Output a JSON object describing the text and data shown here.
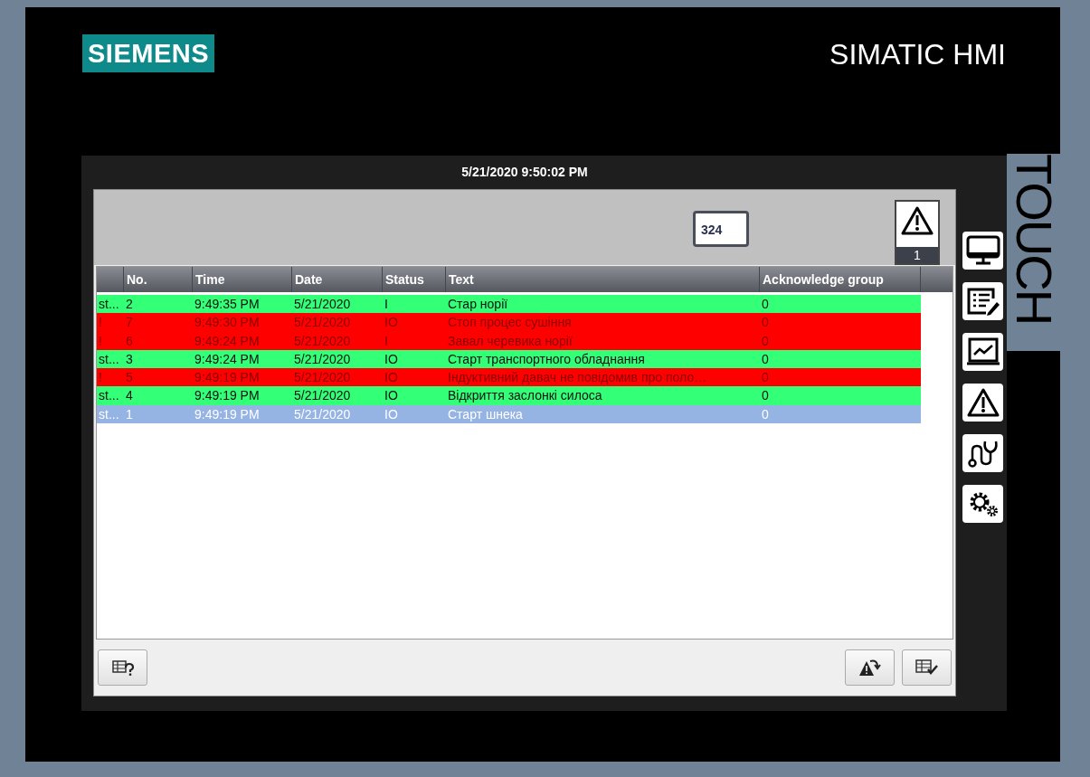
{
  "brand": {
    "logo": "SIEMENS",
    "product": "SIMATIC HMI",
    "edition": "TOUCH"
  },
  "screen": {
    "datetime": "5/21/2020 9:50:02 PM"
  },
  "alarm_view": {
    "counter": "324",
    "indicator_count": "1",
    "columns": [
      "",
      "No.",
      "Time",
      "Date",
      "Status",
      "Text",
      "Acknowledge group"
    ],
    "rows": [
      {
        "cells": [
          "st...",
          "2",
          "9:49:35 PM",
          "5/21/2020",
          "I",
          "Стар норії",
          "0"
        ],
        "kind": "status",
        "color": "#33ff77",
        "selected": false
      },
      {
        "cells": [
          "!",
          "7",
          "9:49:30 PM",
          "5/21/2020",
          "IO",
          "Стоп процес сушіння",
          "0"
        ],
        "kind": "alarm",
        "color": "#ff0000",
        "selected": false
      },
      {
        "cells": [
          "!",
          "6",
          "9:49:24 PM",
          "5/21/2020",
          "I",
          "Завал черевика норії",
          "0"
        ],
        "kind": "alarm",
        "color": "#ff0000",
        "selected": false
      },
      {
        "cells": [
          "st...",
          "3",
          "9:49:24 PM",
          "5/21/2020",
          "IO",
          "Старт транспортного обладнання",
          "0"
        ],
        "kind": "status",
        "color": "#33ff77",
        "selected": false
      },
      {
        "cells": [
          "!",
          "5",
          "9:49:19 PM",
          "5/21/2020",
          "IO",
          "Індуктивний давач не повідомив про поло…",
          "0"
        ],
        "kind": "alarm",
        "color": "#ff0000",
        "selected": false
      },
      {
        "cells": [
          "st...",
          "4",
          "9:49:19 PM",
          "5/21/2020",
          "IO",
          "Відкриття заслонкі силоса",
          "0"
        ],
        "kind": "status",
        "color": "#33ff77",
        "selected": false
      },
      {
        "cells": [
          "st...",
          "1",
          "9:49:19 PM",
          "5/21/2020",
          "IO",
          "Старт шнека",
          "0"
        ],
        "kind": "status",
        "selected": true
      }
    ]
  }
}
